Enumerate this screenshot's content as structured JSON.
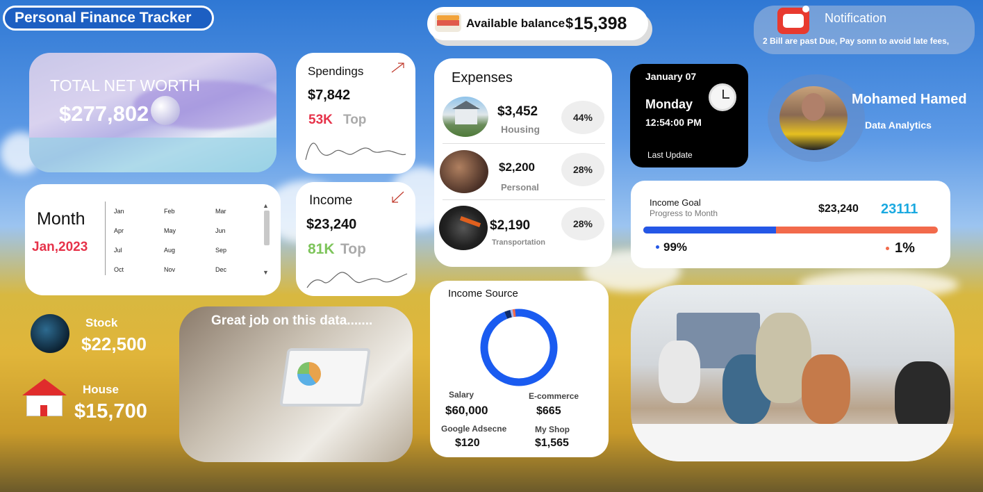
{
  "header": {
    "title": "Personal Finance Tracker"
  },
  "balance": {
    "label": "Available balance",
    "currency": "$",
    "amount": "15,398"
  },
  "notification": {
    "title": "Notification",
    "message": "2 Bill are past Due, Pay sonn to avoid late fees,"
  },
  "networth": {
    "label": "TOTAL NET WORTH",
    "value": "$277,802"
  },
  "spendings": {
    "title": "Spendings",
    "value": "$7,842",
    "top_value": "53K",
    "top_label": "Top"
  },
  "income": {
    "title": "Income",
    "value": "$23,240",
    "top_value": "81K",
    "top_label": "Top"
  },
  "month": {
    "label": "Month",
    "selected": "Jan,2023",
    "options": [
      "Jan",
      "Feb",
      "Mar",
      "Apr",
      "May",
      "Jun",
      "Jul",
      "Aug",
      "Sep",
      "Oct",
      "Nov",
      "Dec"
    ]
  },
  "expenses": {
    "title": "Expenses",
    "items": [
      {
        "amount": "$3,452",
        "label": "Housing",
        "percent": "44%"
      },
      {
        "amount": "$2,200",
        "label": "Personal",
        "percent": "28%"
      },
      {
        "amount": "$2,190",
        "label": "Transportation",
        "percent": "28%"
      }
    ]
  },
  "clock": {
    "date": "January 07",
    "day": "Monday",
    "time": "12:54:00 PM",
    "update_label": "Last Update"
  },
  "profile": {
    "name": "Mohamed Hamed",
    "role": "Data Analytics"
  },
  "income_goal": {
    "title": "Income Goal",
    "subtitle": "Progress to Month",
    "value": "$23,240",
    "target": "23111",
    "progress_fraction": 0.45,
    "left_pct": "99%",
    "right_pct": "1%",
    "colors": {
      "blue": "#2457e6",
      "orange": "#f26a4b",
      "target": "#1aa9e0"
    }
  },
  "assets": [
    {
      "label": "Stock",
      "value": "$22,500"
    },
    {
      "label": "House",
      "value": "$15,700"
    }
  ],
  "banner": {
    "text": "Great job on this data......."
  },
  "income_source": {
    "title": "Income Source",
    "items": [
      {
        "label": "Salary",
        "value": "$60,000"
      },
      {
        "label": "E-commerce",
        "value": "$665"
      },
      {
        "label": "Google Adsecne",
        "value": "$120"
      },
      {
        "label": "My Shop",
        "value": "$1,565"
      }
    ]
  },
  "chart_data": {
    "type": "pie",
    "title": "Income Source",
    "categories": [
      "Salary",
      "E-commerce",
      "Google Adsecne",
      "My Shop"
    ],
    "values": [
      60000,
      665,
      120,
      1565
    ],
    "colors": [
      "#1a5bf0",
      "#f26a4b",
      "#9db5ef",
      "#0d2a6b"
    ]
  }
}
